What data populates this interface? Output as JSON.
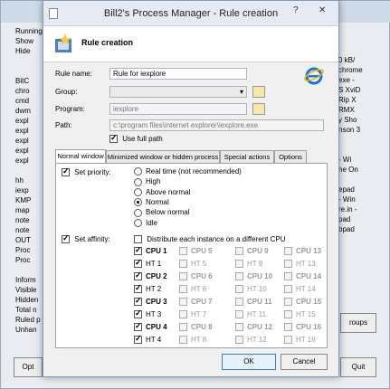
{
  "background": {
    "side_labels": [
      "Running",
      "Show",
      "Hide",
      "",
      "",
      "BitC",
      "chro",
      "cmd",
      "dwm",
      "expl",
      "expl",
      "expl",
      "expl",
      "expl",
      "",
      "hh",
      "iexp",
      "KMP",
      "map",
      "note",
      "note",
      "OUT",
      "Proc",
      "Proc",
      "",
      "Inform",
      "Visible",
      "Hidden",
      "Total n",
      "Ruled p",
      "Unhan"
    ],
    "right_labels": [
      "0 kB/",
      "chrome",
      "exe - ",
      "S XviD",
      "Rip X",
      "RMX",
      "y Sho",
      "nson 3",
      "",
      "",
      "- Wi",
      "he On",
      "",
      "epad",
      "- Win",
      "re.in -",
      "pad",
      "bpad"
    ],
    "groups_button": "roups",
    "options_button": "Opt",
    "quit_button": "Quit"
  },
  "dialog": {
    "title": "Bill2's Process Manager - Rule creation",
    "header_title": "Rule creation",
    "rule_name_label": "Rule name:",
    "rule_name_value": "Rule for iexplore",
    "group_label": "Group:",
    "group_value": "",
    "program_label": "Program:",
    "program_value": "iexplore",
    "path_label": "Path:",
    "path_value": "c:\\program files\\internet explorer\\iexplore.exe",
    "use_full_path": "Use full path",
    "tabs": [
      "Normal window",
      "Minimized window or hidden process",
      "Special actions",
      "Options"
    ],
    "set_priority": "Set priority:",
    "priorities": [
      "Real time (not recommended)",
      "High",
      "Above normal",
      "Normal",
      "Below normal",
      "Idle"
    ],
    "selected_priority": "Normal",
    "set_affinity": "Set affinity:",
    "distribute": "Distribute each instance on a different CPU",
    "cpu_grid": [
      [
        "CPU 1",
        "CPU 5",
        "CPU 9",
        "CPU 13"
      ],
      [
        "HT 1",
        "HT 5",
        "HT 9",
        "HT 13"
      ],
      [
        "CPU 2",
        "CPU 6",
        "CPU 10",
        "CPU 14"
      ],
      [
        "HT 2",
        "HT 6",
        "HT 10",
        "HT 14"
      ],
      [
        "CPU 3",
        "CPU 7",
        "CPU 11",
        "CPU 15"
      ],
      [
        "HT 3",
        "HT 7",
        "HT 11",
        "HT 15"
      ],
      [
        "CPU 4",
        "CPU 8",
        "CPU 12",
        "CPU 16"
      ],
      [
        "HT 4",
        "HT 8",
        "HT 12",
        "HT 16"
      ]
    ],
    "ok": "OK",
    "cancel": "Cancel"
  }
}
